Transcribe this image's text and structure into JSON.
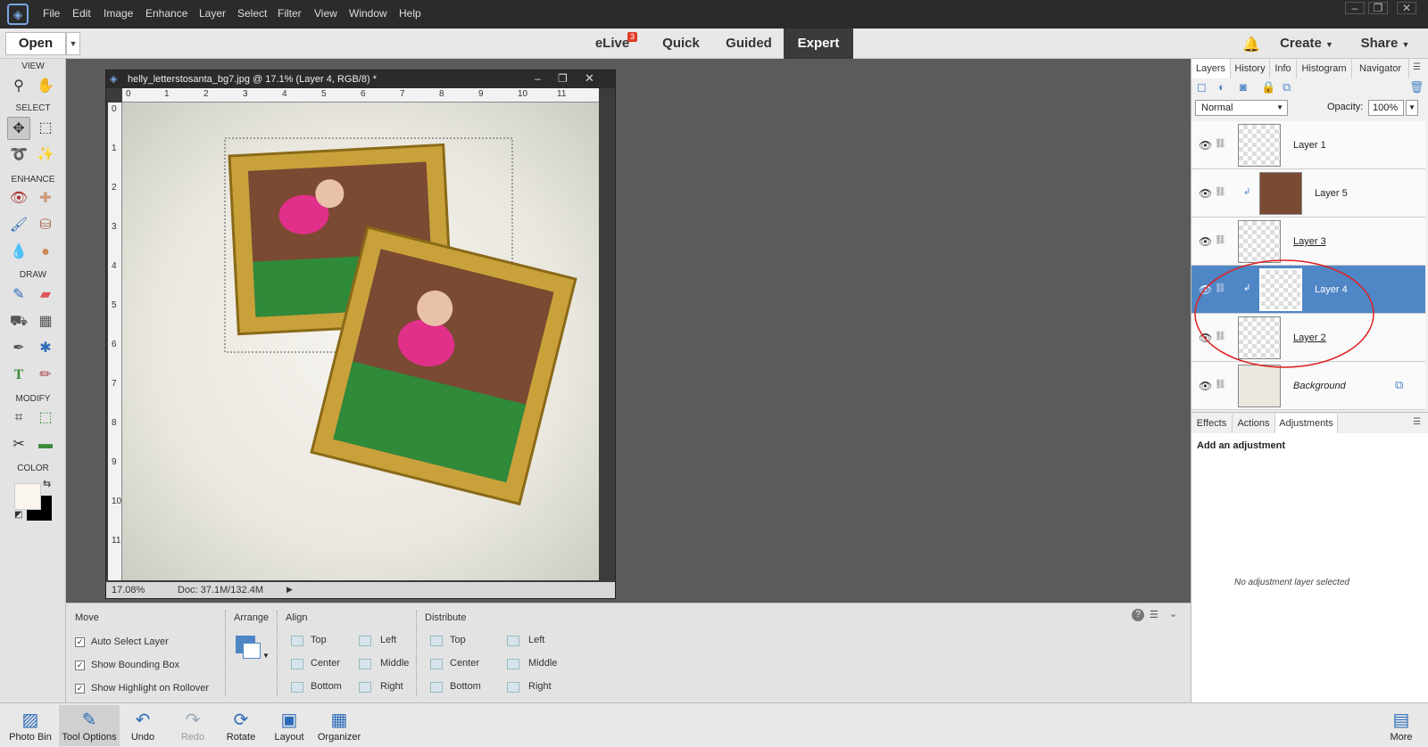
{
  "menu": {
    "items": [
      "File",
      "Edit",
      "Image",
      "Enhance",
      "Layer",
      "Select",
      "Filter",
      "View",
      "Window",
      "Help"
    ],
    "window_controls": [
      "–",
      "❐",
      "✕"
    ]
  },
  "modebar": {
    "open": "Open",
    "elive": "eLive",
    "elive_badge": "3",
    "quick": "Quick",
    "guided": "Guided",
    "expert": "Expert",
    "create": "Create",
    "share": "Share"
  },
  "toolbox": {
    "view": "VIEW",
    "select": "SELECT",
    "enhance": "ENHANCE",
    "draw": "DRAW",
    "modify": "MODIFY",
    "color": "COLOR"
  },
  "document": {
    "title": "helly_letterstosanta_bg7.jpg @ 17.1% (Layer 4, RGB/8) *",
    "zoom": "17.08%",
    "doc_size": "Doc: 37.1M/132.4M",
    "ruler_h": [
      "0",
      "1",
      "2",
      "3",
      "4",
      "5",
      "6",
      "7",
      "8",
      "9",
      "10",
      "11"
    ],
    "ruler_v": [
      "0",
      "1",
      "2",
      "3",
      "4",
      "5",
      "6",
      "7",
      "8",
      "9",
      "10",
      "11"
    ]
  },
  "options": {
    "move": "Move",
    "auto_select": "Auto Select Layer",
    "show_bbox": "Show Bounding Box",
    "show_highlight": "Show Highlight on Rollover",
    "arrange": "Arrange",
    "align": "Align",
    "distribute": "Distribute",
    "align_items": [
      "Top",
      "Center",
      "Bottom",
      "Left",
      "Middle",
      "Right"
    ],
    "distribute_items": [
      "Top",
      "Center",
      "Bottom",
      "Left",
      "Middle",
      "Right"
    ]
  },
  "bottom": {
    "photo_bin": "Photo Bin",
    "tool_options": "Tool Options",
    "undo": "Undo",
    "redo": "Redo",
    "rotate": "Rotate",
    "layout": "Layout",
    "organizer": "Organizer",
    "more": "More"
  },
  "panel": {
    "tabs": [
      "Layers",
      "History",
      "Info",
      "Histogram",
      "Navigator"
    ],
    "blend_mode": "Normal",
    "opacity_label": "Opacity:",
    "opacity_value": "100%",
    "layers": [
      {
        "name": "Layer 1",
        "selected": false
      },
      {
        "name": "Layer 5",
        "selected": false
      },
      {
        "name": "Layer 3",
        "selected": false
      },
      {
        "name": "Layer 4",
        "selected": true
      },
      {
        "name": "Layer 2",
        "selected": false
      },
      {
        "name": "Background",
        "selected": false
      }
    ],
    "lower_tabs": [
      "Effects",
      "Actions",
      "Adjustments"
    ],
    "add_adjustment": "Add an adjustment",
    "no_adjustment": "No adjustment layer selected"
  },
  "colors": {
    "accent": "#4f86c6",
    "annotation": "#e02020",
    "frame_gold": "#b8902a"
  }
}
